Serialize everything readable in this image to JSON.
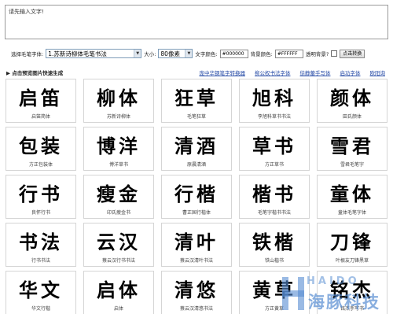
{
  "input": {
    "text": "请先输入文字!"
  },
  "controls": {
    "font_label": "选择毛笔字体:",
    "font_selected": "1.苏新诗柳体毛笔书法",
    "size_label": "大小:",
    "size_selected": "80像素",
    "text_color_label": "文字颜色:",
    "text_color_value": "#000000",
    "bg_color_label": "背景颜色:",
    "bg_color_value": "#FFFFFF",
    "transparent_label": "透明背景?",
    "swap_button": "点击转换"
  },
  "subhead": {
    "title": "▶ 点击预览图片快速生成",
    "links": [
      "庞中华钢笔字转换器",
      "柳公权书法字体",
      "徐静蕾手写体",
      "启功字体",
      "欧阳询"
    ]
  },
  "fonts": [
    {
      "sample": "启笛",
      "caption": "启笛简体"
    },
    {
      "sample": "柳体",
      "caption": "苏新诗柳体"
    },
    {
      "sample": "狂草",
      "caption": "毛笔狂草"
    },
    {
      "sample": "旭科",
      "caption": "李旭科草书书法"
    },
    {
      "sample": "颜体",
      "caption": "田氏颜体"
    },
    {
      "sample": "包装",
      "caption": "方正包装体"
    },
    {
      "sample": "博洋",
      "caption": "博洋草书"
    },
    {
      "sample": "清酒",
      "caption": "原晨清酒"
    },
    {
      "sample": "草书",
      "caption": "方正草书"
    },
    {
      "sample": "雪君",
      "caption": "雪君毛笔字"
    },
    {
      "sample": "行书",
      "caption": "良怀行书"
    },
    {
      "sample": "瘦金",
      "caption": "印氏瘦金书"
    },
    {
      "sample": "行楷",
      "caption": "曹正国行楷体"
    },
    {
      "sample": "楷书",
      "caption": "毛笔字楷书书法"
    },
    {
      "sample": "童体",
      "caption": "童体毛笔字体"
    },
    {
      "sample": "书法",
      "caption": "行书书法"
    },
    {
      "sample": "云汉",
      "caption": "蔡云汉行书书法"
    },
    {
      "sample": "清叶",
      "caption": "蔡云汉清叶书法"
    },
    {
      "sample": "铁楷",
      "caption": "铁山楷书"
    },
    {
      "sample": "刀锋",
      "caption": "叶根友刀锋黑草"
    },
    {
      "sample": "华文",
      "caption": "华文行楷"
    },
    {
      "sample": "启体",
      "caption": "启体"
    },
    {
      "sample": "清悠",
      "caption": "蔡云汉清悠书法"
    },
    {
      "sample": "黄草",
      "caption": "方正黄草"
    },
    {
      "sample": "铭杰",
      "caption": "铭杰手写书"
    }
  ],
  "watermark": {
    "letters": "HAIDO",
    "name": "海豚科技"
  },
  "colors": {
    "link": "#2a4ea8",
    "border": "#d5d5d5",
    "watermark": "#568cd2"
  },
  "icons": [
    "dropdown-arrow-icon",
    "triangle-bullet-icon",
    "watermark-h-logo-icon"
  ]
}
